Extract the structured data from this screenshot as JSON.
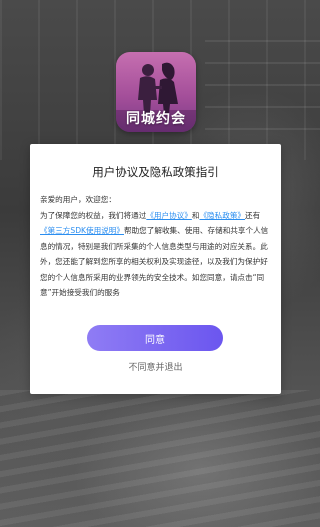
{
  "app": {
    "logo_text": "同城约会"
  },
  "dialog": {
    "title": "用户协议及隐私政策指引",
    "greeting": "亲爱的用户，欢迎您：",
    "para_part1": "为了保障您的权益，我们将通过",
    "link_user_agreement": "《用户协议》",
    "and_text": "和",
    "link_privacy_policy": "《隐私政策》",
    "para_part2": "还有",
    "link_sdk_notes": "《第三方SDK使用说明》",
    "para_part3": "帮助您了解收集、使用、存储和共享个人信息的情况，特别是我们所采集的个人信息类型与用途的对应关系。此外，您还能了解到您所享的相关权利及实现途径，以及我们为保护好您的个人信息所采用的业界领先的安全技术。如您同意，请点击“同意”开始接受我们的服务",
    "agree_label": "同意",
    "disagree_label": "不同意并退出"
  },
  "colors": {
    "link": "#2b8ef0",
    "button_start": "#8f7cf4",
    "button_end": "#6b56ef"
  }
}
